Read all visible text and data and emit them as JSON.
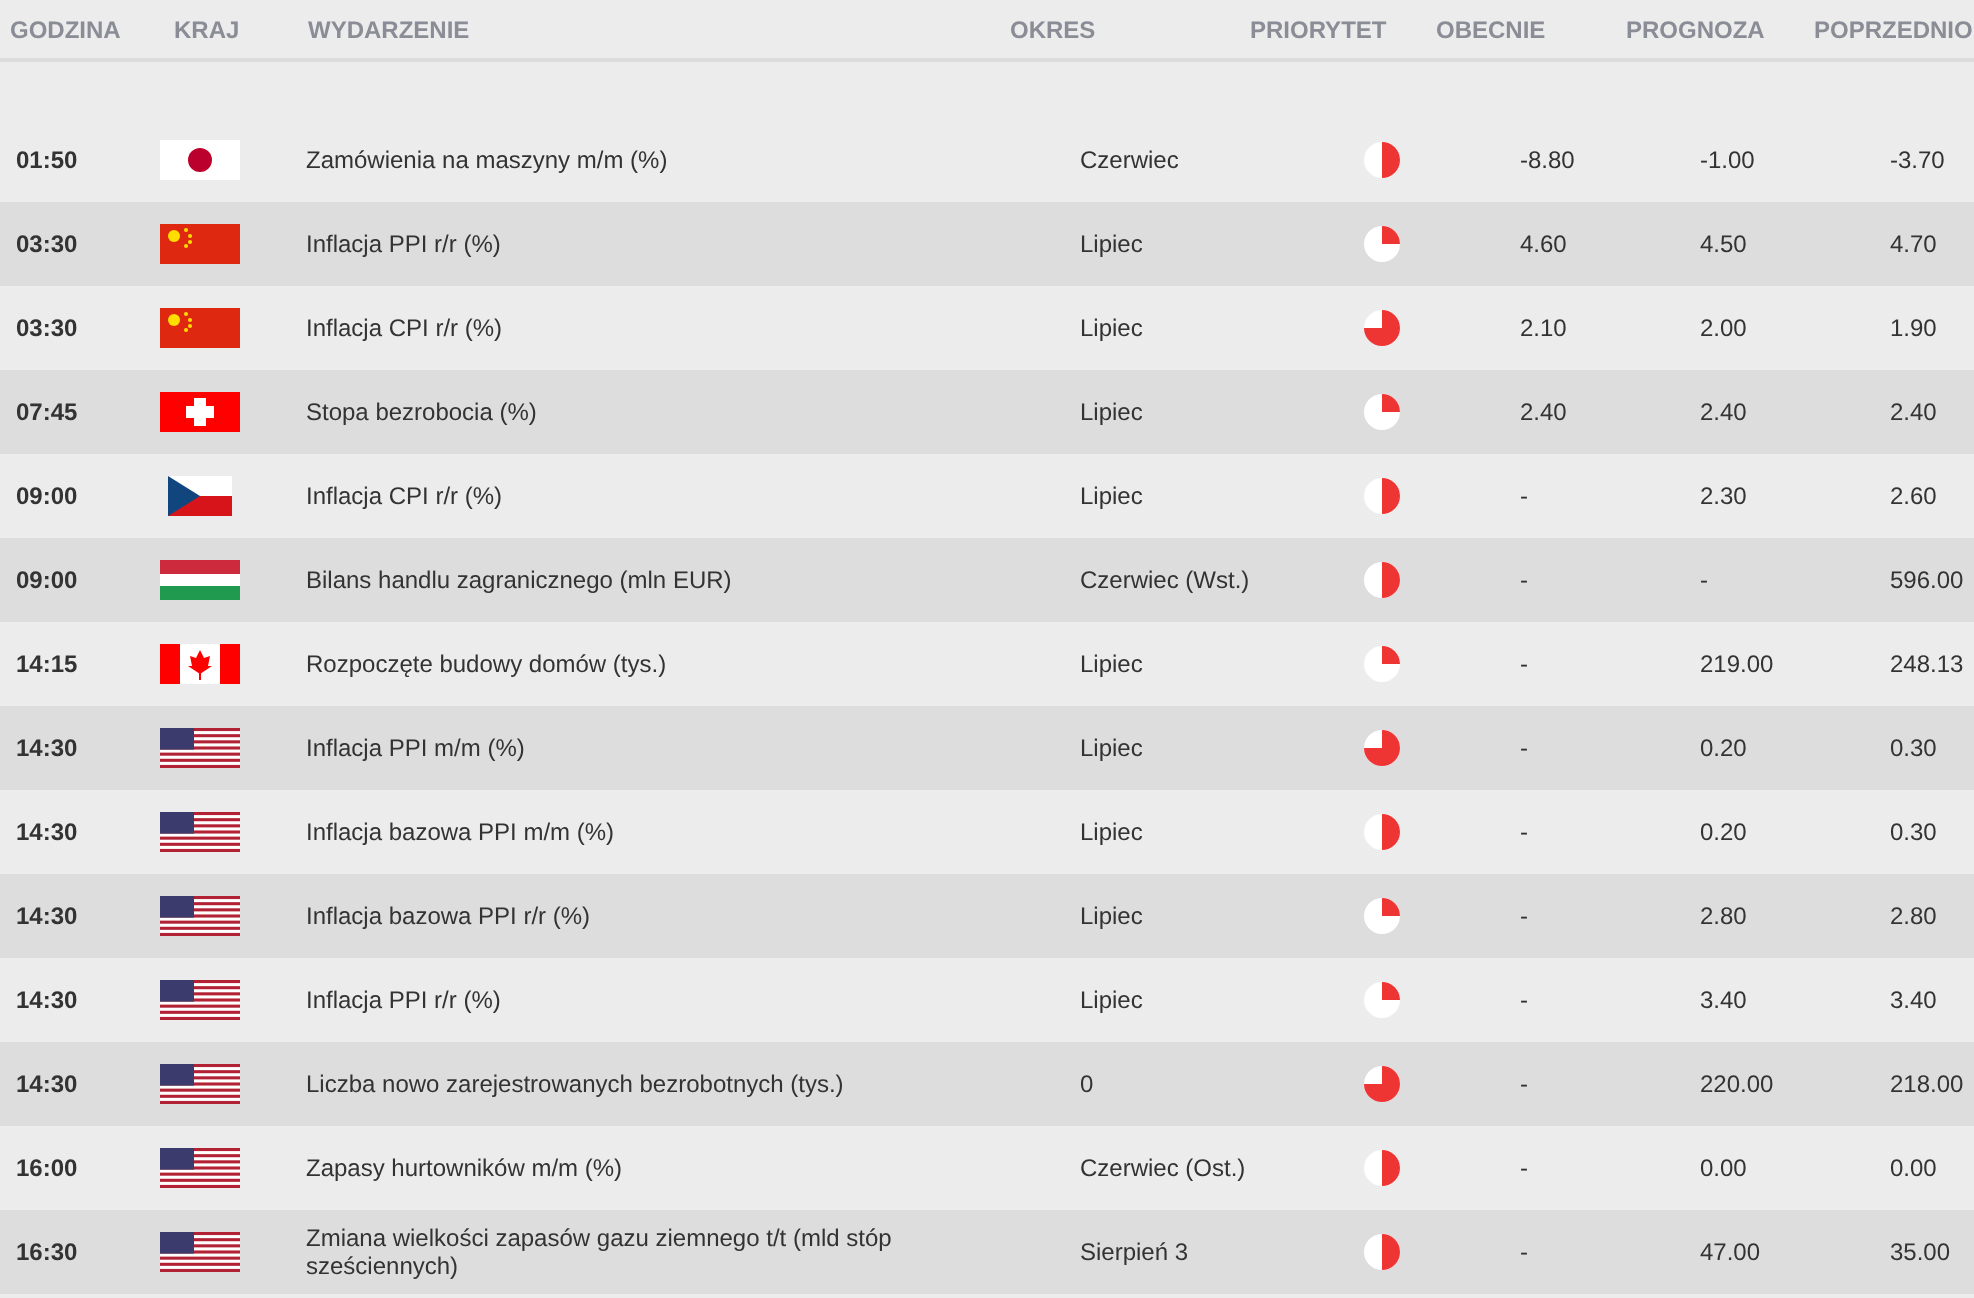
{
  "columns": [
    "GODZINA",
    "KRAJ",
    "WYDARZENIE",
    "OKRES",
    "PRIORYTET",
    "OBECNIE",
    "PROGNOZA",
    "POPRZEDNIO"
  ],
  "rows": [
    {
      "time": "01:50",
      "kind": "jp",
      "event": "Zamówienia na maszyny m/m (%)",
      "period": "Czerwiec",
      "priority": {
        "kind": "medium"
      },
      "actual": "-8.80",
      "forecast": "-1.00",
      "previous": "-3.70"
    },
    {
      "time": "03:30",
      "kind": "cn",
      "event": "Inflacja PPI r/r (%)",
      "period": "Lipiec",
      "priority": {
        "kind": "low"
      },
      "actual": "4.60",
      "forecast": "4.50",
      "previous": "4.70"
    },
    {
      "time": "03:30",
      "kind": "cn",
      "event": "Inflacja CPI r/r (%)",
      "period": "Lipiec",
      "priority": {
        "kind": "high"
      },
      "actual": "2.10",
      "forecast": "2.00",
      "previous": "1.90"
    },
    {
      "time": "07:45",
      "kind": "ch",
      "event": "Stopa bezrobocia (%)",
      "period": "Lipiec",
      "priority": {
        "kind": "low"
      },
      "actual": "2.40",
      "forecast": "2.40",
      "previous": "2.40"
    },
    {
      "time": "09:00",
      "kind": "cz",
      "event": "Inflacja CPI r/r (%)",
      "period": "Lipiec",
      "priority": {
        "kind": "medium"
      },
      "actual": "-",
      "forecast": "2.30",
      "previous": "2.60"
    },
    {
      "time": "09:00",
      "kind": "hu",
      "event": "Bilans handlu zagranicznego (mln EUR)",
      "period": "Czerwiec (Wst.)",
      "priority": {
        "kind": "medium"
      },
      "actual": "-",
      "forecast": "-",
      "previous": "596.00"
    },
    {
      "time": "14:15",
      "kind": "ca",
      "event": "Rozpoczęte budowy domów (tys.)",
      "period": "Lipiec",
      "priority": {
        "kind": "low"
      },
      "actual": "-",
      "forecast": "219.00",
      "previous": "248.13"
    },
    {
      "time": "14:30",
      "kind": "us",
      "event": "Inflacja PPI m/m (%)",
      "period": "Lipiec",
      "priority": {
        "kind": "high"
      },
      "actual": "-",
      "forecast": "0.20",
      "previous": "0.30"
    },
    {
      "time": "14:30",
      "kind": "us",
      "event": "Inflacja bazowa PPI m/m (%)",
      "period": "Lipiec",
      "priority": {
        "kind": "medium"
      },
      "actual": "-",
      "forecast": "0.20",
      "previous": "0.30"
    },
    {
      "time": "14:30",
      "kind": "us",
      "event": "Inflacja bazowa PPI r/r (%)",
      "period": "Lipiec",
      "priority": {
        "kind": "low"
      },
      "actual": "-",
      "forecast": "2.80",
      "previous": "2.80"
    },
    {
      "time": "14:30",
      "kind": "us",
      "event": "Inflacja PPI r/r (%)",
      "period": "Lipiec",
      "priority": {
        "kind": "low"
      },
      "actual": "-",
      "forecast": "3.40",
      "previous": "3.40"
    },
    {
      "time": "14:30",
      "kind": "us",
      "event": "Liczba nowo zarejestrowanych bezrobotnych (tys.)",
      "period": "0",
      "priority": {
        "kind": "high"
      },
      "actual": "-",
      "forecast": "220.00",
      "previous": "218.00"
    },
    {
      "time": "16:00",
      "kind": "us",
      "event": "Zapasy hurtowników m/m (%)",
      "period": "Czerwiec (Ost.)",
      "priority": {
        "kind": "medium"
      },
      "actual": "-",
      "forecast": "0.00",
      "previous": "0.00"
    },
    {
      "time": "16:30",
      "kind": "us",
      "event": "Zmiana wielkości zapasów gazu ziemnego t/t (mld stóp sześciennych)",
      "period": "Sierpień 3",
      "priority": {
        "kind": "medium"
      },
      "actual": "-",
      "forecast": "47.00",
      "previous": "35.00"
    }
  ]
}
